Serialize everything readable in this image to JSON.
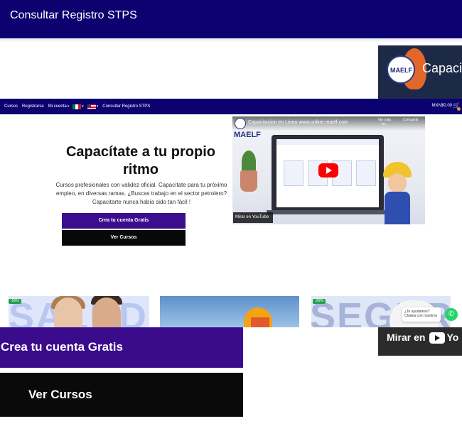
{
  "topbar": {
    "title": "Consultar Registro STPS"
  },
  "bg_video": {
    "title": "Capaci",
    "logo_text": "MAELF"
  },
  "navbar": {
    "items": [
      "Cursos",
      "Registrarse",
      "Mi cuenta"
    ],
    "consultar": "Consultar Registro STPS",
    "cart_total": "MXN$0.00"
  },
  "hero": {
    "title": "Capacítate a tu propio ritmo",
    "description": "Cursos profesionales con validez oficial. Capacítate para tu próximo empleo, en diversas ramas. ¿Buscas trabajo en el sector petrolero? Capacitarte nunca había sido tan fácil !",
    "create_button": "Crea tu cuenta Gratis",
    "courses_button": "Ver Cursos"
  },
  "video": {
    "title": "Capacitacion en Linea www.online.maelf.com",
    "logo_text": "MAELF",
    "watch_later": "Ver más ta...",
    "share": "Compartir",
    "mirar": "Mirar en",
    "youtube": "YouTube"
  },
  "cards": {
    "card1_text": "SALUD",
    "card3_text": "SEGUR",
    "badge1": "-50%",
    "badge3": "-20%"
  },
  "chat": {
    "text": "¿Te ayudamos? Chatea con nosotros"
  },
  "overlay": {
    "create_button": "Crea tu cuenta Gratis",
    "courses_button": "Ver Cursos",
    "mirar": "Mirar en",
    "youtube": "Yo"
  },
  "colors": {
    "brand_navy": "#0b0270",
    "brand_purple": "#3c0d8f",
    "black": "#080808",
    "whatsapp": "#25d366"
  }
}
